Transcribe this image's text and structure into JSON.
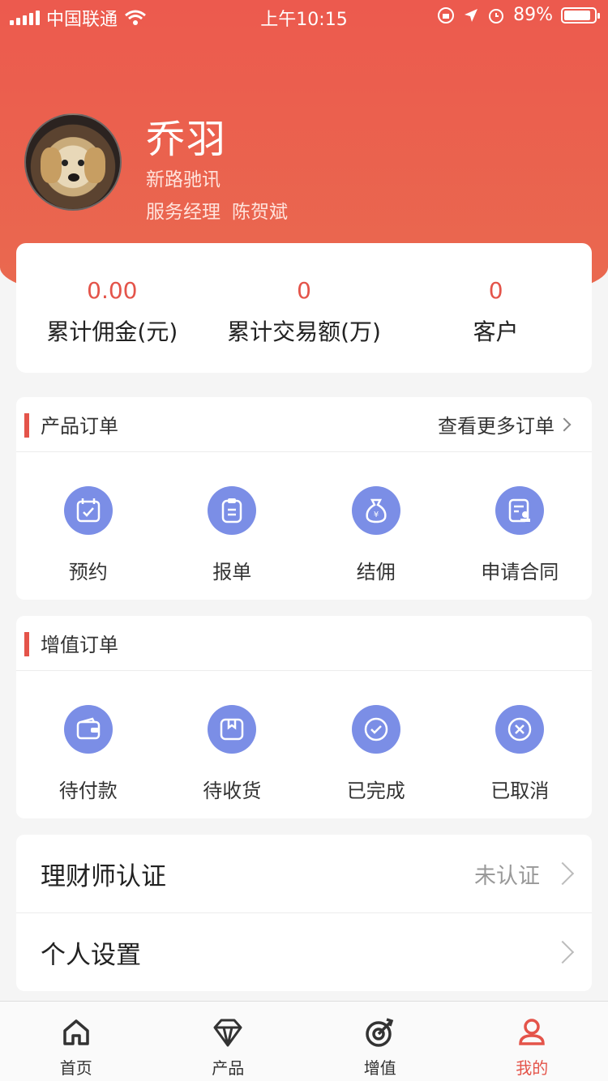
{
  "status_bar": {
    "carrier": "中国联通",
    "time": "上午10:15",
    "battery": "89%",
    "battery_fraction": 0.89
  },
  "profile": {
    "name": "乔羽",
    "company": "新路驰讯",
    "manager_role": "服务经理",
    "manager_name": "陈贺斌"
  },
  "stats": [
    {
      "value": "0.00",
      "label": "累计佣金(元)"
    },
    {
      "value": "0",
      "label": "累计交易额(万)"
    },
    {
      "value": "0",
      "label": "客户"
    }
  ],
  "product_orders": {
    "title": "产品订单",
    "more": "查看更多订单",
    "items": [
      {
        "label": "预约",
        "icon": "calendar-check-icon"
      },
      {
        "label": "报单",
        "icon": "clipboard-icon"
      },
      {
        "label": "结佣",
        "icon": "money-bag-icon"
      },
      {
        "label": "申请合同",
        "icon": "contract-icon"
      }
    ]
  },
  "value_orders": {
    "title": "增值订单",
    "items": [
      {
        "label": "待付款",
        "icon": "wallet-icon"
      },
      {
        "label": "待收货",
        "icon": "package-icon"
      },
      {
        "label": "已完成",
        "icon": "check-circle-icon"
      },
      {
        "label": "已取消",
        "icon": "cancel-circle-icon"
      }
    ]
  },
  "menu": {
    "certification": {
      "label": "理财师认证",
      "status": "未认证"
    },
    "settings": {
      "label": "个人设置"
    }
  },
  "tabbar": {
    "items": [
      {
        "label": "首页",
        "icon": "home-icon"
      },
      {
        "label": "产品",
        "icon": "diamond-icon"
      },
      {
        "label": "增值",
        "icon": "target-icon"
      },
      {
        "label": "我的",
        "icon": "user-icon"
      }
    ],
    "active": "我的"
  },
  "colors": {
    "accent": "#e4544a",
    "icon_bg": "#7b8ee6"
  }
}
